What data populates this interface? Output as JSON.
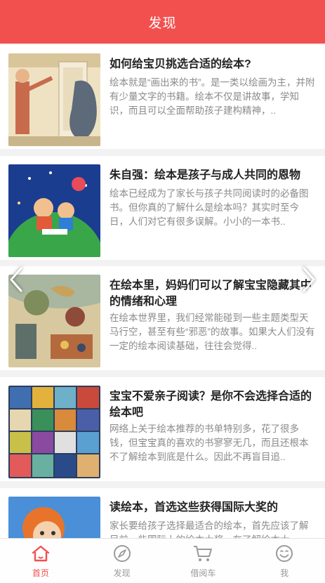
{
  "header": {
    "title": "发现"
  },
  "articles": [
    {
      "title": "如何给宝贝挑选合适的绘本?",
      "desc": "绘本就是“画出来的书”。是一类以绘画为主，并附有少量文字的书籍。绘本不仅是讲故事，学知识，而且可以全面帮助孩子建构精神，.."
    },
    {
      "title": "朱自强：绘本是孩子与成人共同的恩物",
      "desc": "绘本已经成为了家长与孩子共同阅读时的必备图书。但你真的了解什么是绘本吗？其实时至今日，人们对它有很多误解。小小的一本书.."
    },
    {
      "title": "在绘本里，妈妈们可以了解宝宝隐藏其中的情绪和心理",
      "desc": "在绘本世界里，我们经常能碰到一些主题类型天马行空，甚至有些“邪恶”的故事。如果大人们没有一定的绘本阅读基础，往往会觉得.."
    },
    {
      "title": "宝宝不爱亲子阅读？是你不会选择合适的绘本吧",
      "desc": "网络上关于绘本推荐的书单特别多，花了很多钱，但宝宝真的喜欢的书寥寥无几，而且还根本不了解绘本到底是什么。因此不再盲目追.."
    },
    {
      "title": "读绘本，首选这些获得国际大奖的",
      "desc": "家长要给孩子选择最适合的绘本，首先应该了解目前一些国际上的绘本大奖，在了解绘本大"
    }
  ],
  "tabbar": {
    "items": [
      {
        "label": "首页",
        "icon": "home-icon",
        "active": true
      },
      {
        "label": "发现",
        "icon": "compass-icon",
        "active": false
      },
      {
        "label": "借阅车",
        "icon": "cart-icon",
        "active": false
      },
      {
        "label": "我",
        "icon": "smile-icon",
        "active": false
      }
    ]
  },
  "colors": {
    "accent": "#f2504f",
    "inactive": "#9a9a9a"
  }
}
